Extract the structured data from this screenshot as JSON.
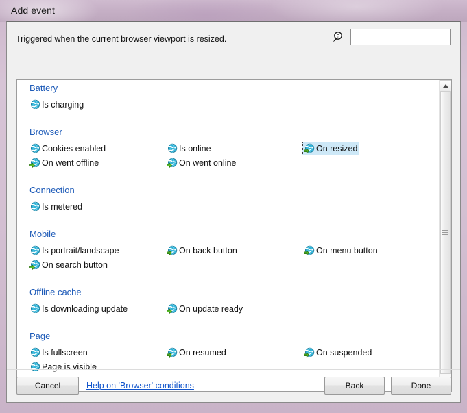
{
  "window": {
    "title": "Add event"
  },
  "header": {
    "description": "Triggered when the current browser viewport is resized.",
    "search": {
      "value": "",
      "placeholder": "",
      "icon": "search-help-icon"
    }
  },
  "groups": [
    {
      "title": "Battery",
      "items": [
        {
          "label": "Is charging",
          "icon": "globe-condition-icon",
          "selected": false
        }
      ]
    },
    {
      "title": "Browser",
      "items": [
        {
          "label": "Cookies enabled",
          "icon": "globe-condition-icon",
          "selected": false
        },
        {
          "label": "Is online",
          "icon": "globe-condition-icon",
          "selected": false
        },
        {
          "label": "On resized",
          "icon": "globe-event-icon",
          "selected": true
        },
        {
          "label": "On went offline",
          "icon": "globe-event-icon",
          "selected": false
        },
        {
          "label": "On went online",
          "icon": "globe-event-icon",
          "selected": false
        }
      ]
    },
    {
      "title": "Connection",
      "items": [
        {
          "label": "Is metered",
          "icon": "globe-condition-icon",
          "selected": false
        }
      ]
    },
    {
      "title": "Mobile",
      "items": [
        {
          "label": "Is portrait/landscape",
          "icon": "globe-condition-icon",
          "selected": false
        },
        {
          "label": "On back button",
          "icon": "globe-event-icon",
          "selected": false
        },
        {
          "label": "On menu button",
          "icon": "globe-event-icon",
          "selected": false
        },
        {
          "label": "On search button",
          "icon": "globe-event-icon",
          "selected": false
        }
      ]
    },
    {
      "title": "Offline cache",
      "items": [
        {
          "label": "Is downloading update",
          "icon": "globe-condition-icon",
          "selected": false
        },
        {
          "label": "On update ready",
          "icon": "globe-event-icon",
          "selected": false
        }
      ]
    },
    {
      "title": "Page",
      "items": [
        {
          "label": "Is fullscreen",
          "icon": "globe-condition-icon",
          "selected": false
        },
        {
          "label": "On resumed",
          "icon": "globe-event-icon",
          "selected": false
        },
        {
          "label": "On suspended",
          "icon": "globe-event-icon",
          "selected": false
        },
        {
          "label": "Page is visible",
          "icon": "globe-condition-icon",
          "selected": false
        }
      ]
    }
  ],
  "scrollbar": {
    "up_arrow": "chevron-up-icon",
    "down_arrow": "chevron-down-icon"
  },
  "footer": {
    "cancel_label": "Cancel",
    "help_link_label": "Help on 'Browser' conditions",
    "back_label": "Back",
    "done_label": "Done"
  },
  "colors": {
    "group_title": "#1e5bb8",
    "link": "#1155cc",
    "selection_bg": "#cde8f7",
    "titlebar": "#c6b0c6"
  }
}
